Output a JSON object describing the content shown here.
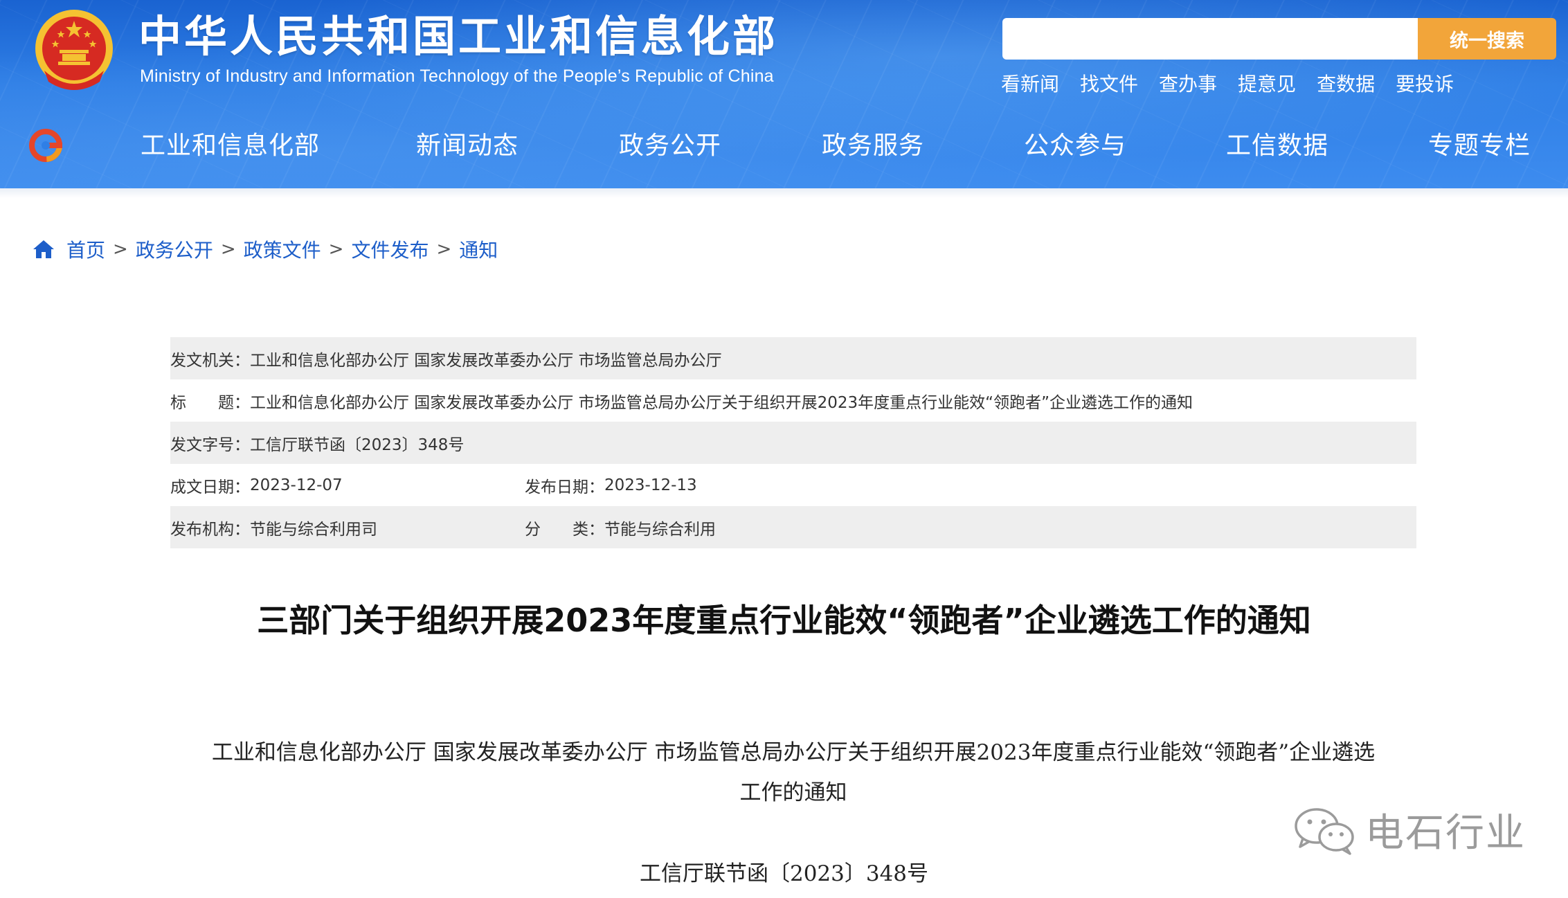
{
  "header": {
    "title_cn": "中华人民共和国工业和信息化部",
    "title_en": "Ministry of Industry and Information Technology of the People’s Republic of China",
    "search": {
      "placeholder": "",
      "button_label": "统一搜索"
    },
    "quicklinks": [
      "看新闻",
      "找文件",
      "查办事",
      "提意见",
      "查数据",
      "要投诉"
    ],
    "nav": [
      "工业和信息化部",
      "新闻动态",
      "政务公开",
      "政务服务",
      "公众参与",
      "工信数据",
      "专题专栏"
    ]
  },
  "breadcrumb": [
    "首页",
    "政务公开",
    "政策文件",
    "文件发布",
    "通知"
  ],
  "breadcrumb_separator": ">",
  "info": {
    "issuer_label": "发文机关：",
    "issuer": "工业和信息化部办公厅 国家发展改革委办公厅 市场监管总局办公厅",
    "subject_label": "标　　题：",
    "subject": "工业和信息化部办公厅 国家发展改革委办公厅 市场监管总局办公厅关于组织开展2023年度重点行业能效“领跑者”企业遴选工作的通知",
    "doc_no_label": "发文字号：",
    "doc_no": "工信厅联节函〔2023〕348号",
    "written_date_label": "成文日期：",
    "written_date": "2023-12-07",
    "publish_date_label": "发布日期：",
    "publish_date": "2023-12-13",
    "org_label": "发布机构：",
    "org": "节能与综合利用司",
    "category_label": "分　　类：",
    "category": "节能与综合利用"
  },
  "main_title": "三部门关于组织开展2023年度重点行业能效“领跑者”企业遴选工作的通知",
  "body": {
    "doc_title_line1": "工业和信息化部办公厅  国家发展改革委办公厅  市场监管总局办公厅关于组织开展2023年度重点行业能效“领跑者”企业遴选",
    "doc_title_line2": "工作的通知",
    "doc_number": "工信厅联节函〔2023〕348号"
  },
  "watermark": {
    "text": "电石行业",
    "icon": "wechat-icon"
  },
  "colors": {
    "header_blue": "#2f7fe6",
    "search_button": "#f2a53a",
    "link_blue": "#1d5ec9",
    "row_shade": "#eeeeee"
  }
}
